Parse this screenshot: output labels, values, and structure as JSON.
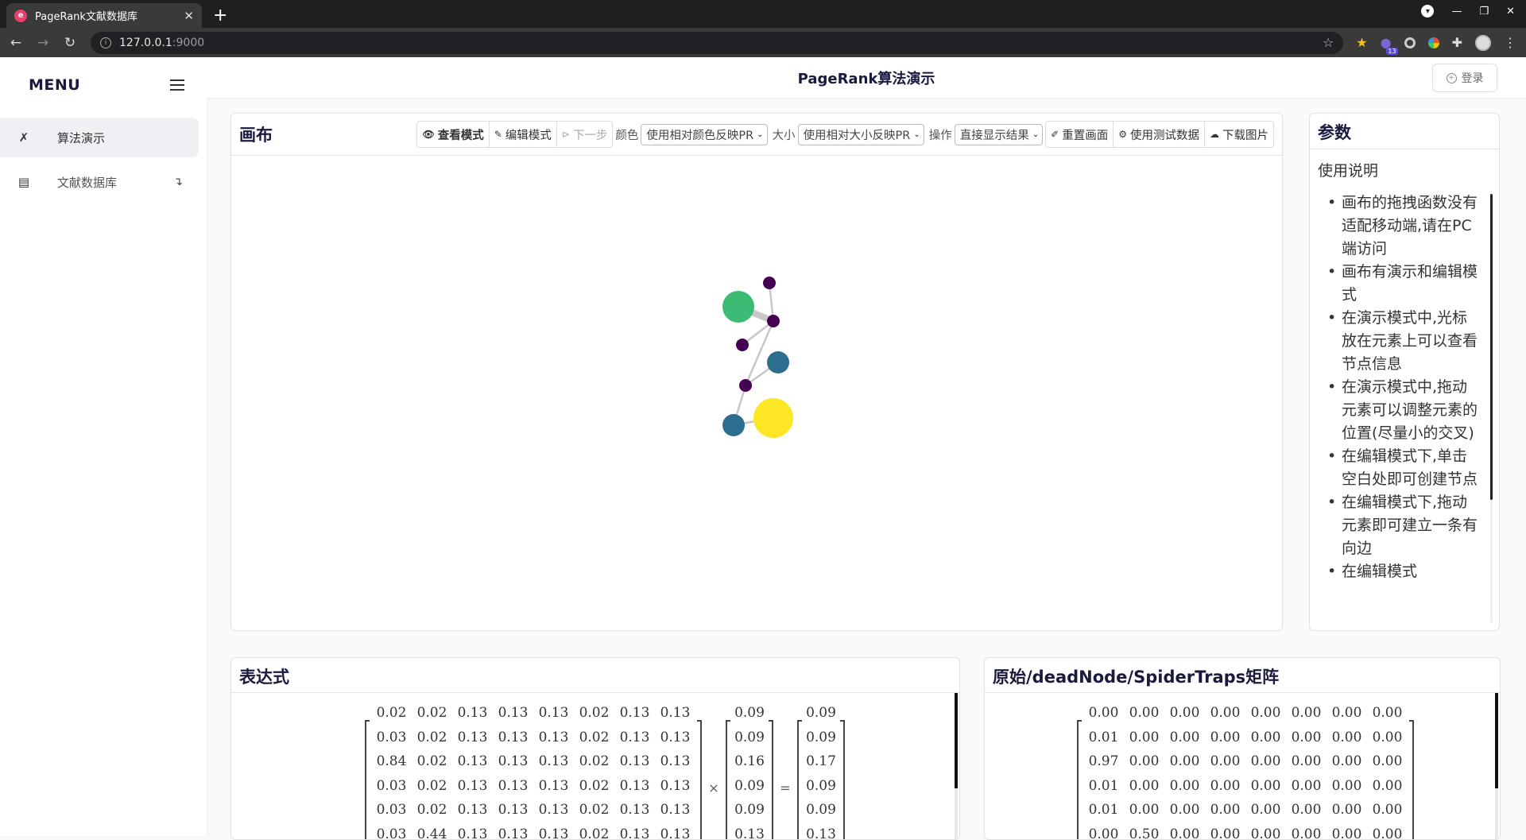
{
  "browser": {
    "tab_title": "PageRank文献数据库",
    "url_host": "127.0.0.1",
    "url_port": ":9000",
    "ext_badge": "13"
  },
  "sidebar": {
    "title": "MENU",
    "items": [
      {
        "label": "算法演示",
        "icon": "tools-icon"
      },
      {
        "label": "文献数据库",
        "icon": "table-icon"
      }
    ]
  },
  "header": {
    "title": "PageRank算法演示",
    "login_label": "登录"
  },
  "canvas": {
    "title": "画布",
    "toolbar": {
      "view_mode": "查看模式",
      "edit_mode": "编辑模式",
      "next_step": "下一步",
      "color_label": "颜色",
      "color_select": "使用相对颜色反映PR",
      "size_label": "大小",
      "size_select": "使用相对大小反映PR",
      "op_label": "操作",
      "op_select": "直接显示结果",
      "redraw": "重置画面",
      "test_data": "使用测试数据",
      "download": "下载图片"
    },
    "node_colors": {
      "purple": "#440154",
      "teal": "#2d6e8e",
      "green": "#3cbb75",
      "yellow": "#fde725",
      "edge": "#c8c8c8"
    }
  },
  "params": {
    "title": "参数",
    "usage_title": "使用说明",
    "usage_items": [
      "画布的拖拽函数没有适配移动端,请在PC端访问",
      "画布有演示和编辑模式",
      "在演示模式中,光标放在元素上可以查看节点信息",
      "在演示模式中,拖动元素可以调整元素的位置(尽量小的交叉)",
      "在编辑模式下,单击空白处即可创建节点",
      "在编辑模式下,拖动元素即可建立一条有向边",
      "在编辑模式"
    ]
  },
  "expression": {
    "title": "表达式",
    "matrix": [
      [
        "0.02",
        "0.02",
        "0.13",
        "0.13",
        "0.13",
        "0.02",
        "0.13",
        "0.13"
      ],
      [
        "0.03",
        "0.02",
        "0.13",
        "0.13",
        "0.13",
        "0.02",
        "0.13",
        "0.13"
      ],
      [
        "0.84",
        "0.02",
        "0.13",
        "0.13",
        "0.13",
        "0.02",
        "0.13",
        "0.13"
      ],
      [
        "0.03",
        "0.02",
        "0.13",
        "0.13",
        "0.13",
        "0.02",
        "0.13",
        "0.13"
      ],
      [
        "0.03",
        "0.02",
        "0.13",
        "0.13",
        "0.13",
        "0.02",
        "0.13",
        "0.13"
      ],
      [
        "0.03",
        "0.44",
        "0.13",
        "0.13",
        "0.13",
        "0.02",
        "0.13",
        "0.13"
      ]
    ],
    "vector_in": [
      "0.09",
      "0.09",
      "0.16",
      "0.09",
      "0.09",
      "0.13"
    ],
    "times": "×",
    "equals": "=",
    "vector_out": [
      "0.09",
      "0.09",
      "0.17",
      "0.09",
      "0.09",
      "0.13"
    ]
  },
  "raw_matrix": {
    "title": "原始/deadNode/SpiderTraps矩阵",
    "matrix": [
      [
        "0.00",
        "0.00",
        "0.00",
        "0.00",
        "0.00",
        "0.00",
        "0.00",
        "0.00"
      ],
      [
        "0.01",
        "0.00",
        "0.00",
        "0.00",
        "0.00",
        "0.00",
        "0.00",
        "0.00"
      ],
      [
        "0.97",
        "0.00",
        "0.00",
        "0.00",
        "0.00",
        "0.00",
        "0.00",
        "0.00"
      ],
      [
        "0.01",
        "0.00",
        "0.00",
        "0.00",
        "0.00",
        "0.00",
        "0.00",
        "0.00"
      ],
      [
        "0.01",
        "0.00",
        "0.00",
        "0.00",
        "0.00",
        "0.00",
        "0.00",
        "0.00"
      ],
      [
        "0.00",
        "0.50",
        "0.00",
        "0.00",
        "0.00",
        "0.00",
        "0.00",
        "0.00"
      ]
    ]
  }
}
